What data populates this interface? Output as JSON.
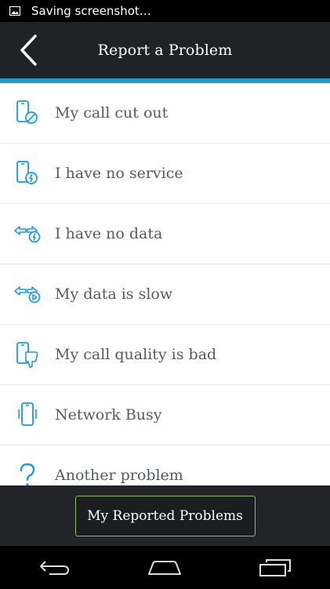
{
  "status_bar": {
    "text": "Saving screenshot…",
    "icon": "image-icon"
  },
  "header": {
    "title": "Report a Problem",
    "back_icon": "back-chevron-icon"
  },
  "accent_color": "#1e9bd7",
  "problems": [
    {
      "label": "My call cut out",
      "icon": "phone-blocked-icon"
    },
    {
      "label": "I have no service",
      "icon": "phone-bolt-icon"
    },
    {
      "label": "I have no data",
      "icon": "data-arrows-bolt-icon"
    },
    {
      "label": "My data is slow",
      "icon": "data-arrows-play-icon"
    },
    {
      "label": "My call quality is bad",
      "icon": "phone-thumb-down-icon"
    },
    {
      "label": "Network Busy",
      "icon": "phone-busy-icon"
    },
    {
      "label": "Another problem",
      "icon": "question-mark-icon"
    }
  ],
  "footer": {
    "button_label": "My Reported Problems",
    "button_border_color": "#8bc34a"
  },
  "nav_bar": {
    "back": "nav-back-icon",
    "home": "nav-home-icon",
    "recents": "nav-recents-icon"
  }
}
